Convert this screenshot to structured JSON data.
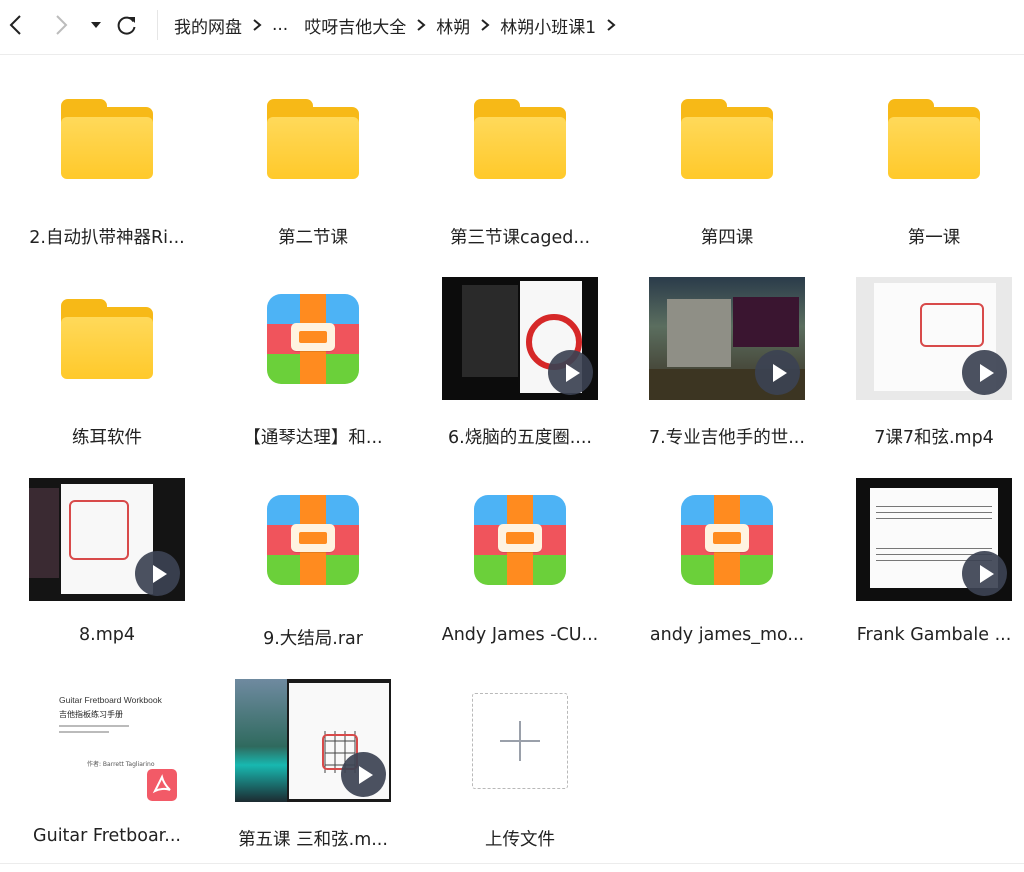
{
  "toolbar": {
    "back_icon": "chevron-left-icon",
    "forward_icon": "chevron-right-icon",
    "dropdown_icon": "caret-down-icon",
    "refresh_icon": "refresh-icon"
  },
  "breadcrumb": {
    "items": [
      "我的网盘",
      "...",
      "哎呀吉他大全",
      "林朔",
      "林朔小班课1"
    ]
  },
  "files": [
    {
      "name": "2.自动扒带神器Ri...",
      "type": "folder"
    },
    {
      "name": "第二节课",
      "type": "folder"
    },
    {
      "name": "第三节课caged...",
      "type": "folder"
    },
    {
      "name": "第四课",
      "type": "folder"
    },
    {
      "name": "第一课",
      "type": "folder"
    },
    {
      "name": "练耳软件",
      "type": "folder"
    },
    {
      "name": "【通琴达理】和...",
      "type": "archive"
    },
    {
      "name": "6.烧脑的五度圈....",
      "type": "video"
    },
    {
      "name": "7.专业吉他手的世...",
      "type": "video"
    },
    {
      "name": "7课7和弦.mp4",
      "type": "video"
    },
    {
      "name": "8.mp4",
      "type": "video"
    },
    {
      "name": "9.大结局.rar",
      "type": "archive"
    },
    {
      "name": "Andy James -CU...",
      "type": "archive"
    },
    {
      "name": "andy james_mo...",
      "type": "archive"
    },
    {
      "name": "Frank Gambale ...",
      "type": "video"
    },
    {
      "name": "Guitar Fretboar...",
      "type": "pdf"
    },
    {
      "name": "第五课 三和弦.m...",
      "type": "video"
    }
  ],
  "pdf_preview": {
    "title": "Guitar Fretboard Workbook",
    "subtitle": "吉他指板练习手册",
    "author": "作者: Barrett Tagliarino"
  },
  "upload": {
    "label": "上传文件"
  },
  "colors": {
    "folder": "#ffc92a",
    "play_button": "#3c4252",
    "pdf_badge": "#f25a67"
  }
}
